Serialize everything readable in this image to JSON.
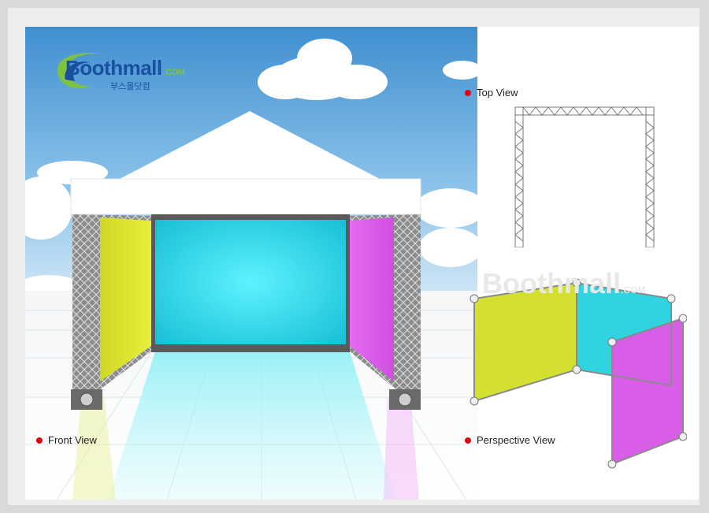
{
  "logo": {
    "brand": "Boothmall",
    "domain": ".COM",
    "korean": "부스몰닷컴"
  },
  "labels": {
    "top_view": "Top View",
    "front_view": "Front View",
    "perspective_view": "Perspective View"
  },
  "watermark": {
    "brand": "Boothmall",
    "domain": ".COM"
  },
  "colors": {
    "yellow_panel": "#d7e22a",
    "cyan_panel": "#27d6e8",
    "magenta_panel": "#e15ff0",
    "bullet": "#e60012",
    "logo_blue": "#1a4fa0",
    "logo_green": "#7ec242"
  },
  "icons": [
    "bullet-dot-icon",
    "boothmall-logo",
    "truss-frame"
  ]
}
